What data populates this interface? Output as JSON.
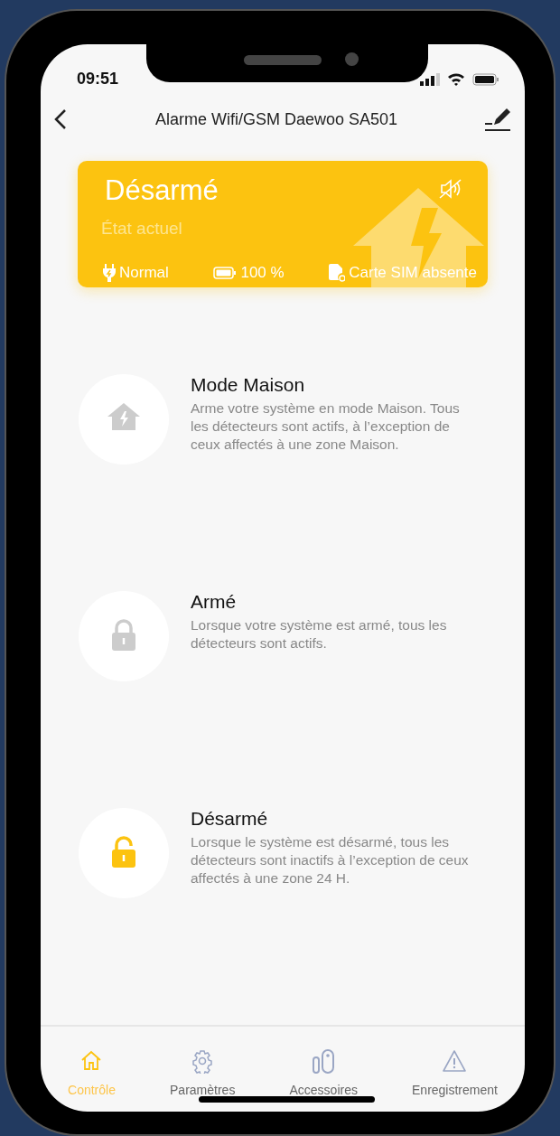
{
  "status_bar": {
    "time": "09:51"
  },
  "header": {
    "title": "Alarme Wifi/GSM Daewoo SA501"
  },
  "status_card": {
    "state": "Désarmé",
    "caption": "État actuel",
    "muted": true,
    "items": [
      {
        "kind": "power",
        "text": "Normal"
      },
      {
        "kind": "battery",
        "text": "100 %"
      },
      {
        "kind": "sim",
        "text": "Carte SIM absente"
      }
    ]
  },
  "modes": [
    {
      "kind": "home",
      "title": "Mode Maison",
      "description": "Arme votre système en mode Maison. Tous les détecteurs sont actifs, à l’exception de ceux affectés à une zone Maison.",
      "selected": false
    },
    {
      "kind": "lock",
      "title": "Armé",
      "description": "Lorsque votre système est armé, tous les détecteurs sont actifs.",
      "selected": false
    },
    {
      "kind": "unlock",
      "title": "Désarmé",
      "description": "Lorsque le système est désarmé, tous les détecteurs sont inactifs à l’exception de ceux affectés à une zone 24 H.",
      "selected": true
    }
  ],
  "tabs": [
    {
      "kind": "home",
      "label": "Contrôle",
      "selected": true
    },
    {
      "kind": "gear",
      "label": "Paramètres",
      "selected": false
    },
    {
      "kind": "sensor",
      "label": "Accessoires",
      "selected": false
    },
    {
      "kind": "warning",
      "label": "Enregistrement",
      "selected": false
    }
  ]
}
